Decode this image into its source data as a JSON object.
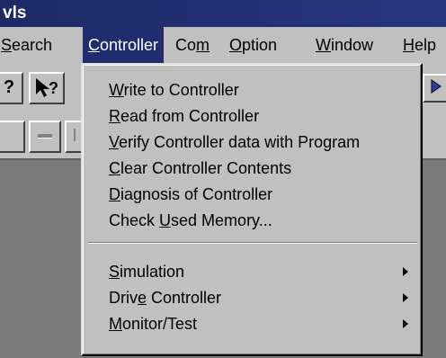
{
  "window": {
    "title_fragment": "vls"
  },
  "menubar": {
    "items": [
      {
        "label": "Search",
        "mn": "S",
        "rest": "earch"
      },
      {
        "label": "Controller",
        "mn": "C",
        "rest": "ontroller"
      },
      {
        "label": "Com",
        "pre": "Co",
        "mn": "m"
      },
      {
        "label": "Option",
        "mn": "O",
        "rest": "ption"
      },
      {
        "label": "Window",
        "mn": "W",
        "rest": "indow"
      },
      {
        "label": "Help",
        "mn": "H",
        "rest": "elp"
      }
    ],
    "active": "Controller"
  },
  "toolbar": {
    "help_glyph": "?",
    "context_help_glyph": "?",
    "partial_glyph": "I"
  },
  "controller_menu": {
    "items": [
      {
        "pre": "",
        "mn": "W",
        "post": "rite to Controller"
      },
      {
        "pre": "",
        "mn": "R",
        "post": "ead from Controller"
      },
      {
        "pre": "",
        "mn": "V",
        "post": "erify Controller data with Program"
      },
      {
        "pre": "",
        "mn": "C",
        "post": "lear Controller Contents"
      },
      {
        "pre": "",
        "mn": "D",
        "post": "iagnosis of Controller"
      },
      {
        "pre": "Check ",
        "mn": "U",
        "post": "sed Memory..."
      },
      {
        "pre": "",
        "mn": "S",
        "post": "imulation",
        "submenu": true
      },
      {
        "pre": "Driv",
        "mn": "e",
        "post": " Controller",
        "submenu": true
      },
      {
        "pre": "",
        "mn": "M",
        "post": "onitor/Test",
        "submenu": true
      }
    ]
  }
}
